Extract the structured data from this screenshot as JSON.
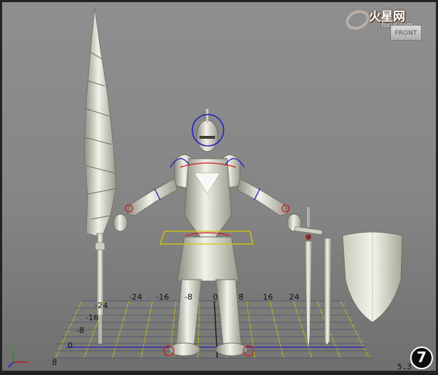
{
  "viewport": {
    "view_label": "FRONT",
    "step_number": "7",
    "coord_readout": "5.3"
  },
  "watermark": {
    "logo_text": "火星网",
    "url": "hxsd.com"
  },
  "grid_labels": {
    "x_ticks": [
      "-24",
      "-16",
      "-8",
      "0",
      "8",
      "16",
      "24"
    ],
    "y_ticks": [
      "-24",
      "-16",
      "-8",
      "0",
      "8"
    ]
  },
  "colors": {
    "grid": "#1e2a6a",
    "grid_axis": "#1c1c1c",
    "grid_yellow": "#d8c800",
    "ik_red": "#d01818",
    "ik_blue": "#2020c0",
    "armor": "#e6e6d8",
    "background": "#8a8a8a"
  },
  "icons": {
    "axis": "axis-tripod-icon",
    "viewcube": "viewcube-icon",
    "logo": "hxsd-logo-icon"
  }
}
